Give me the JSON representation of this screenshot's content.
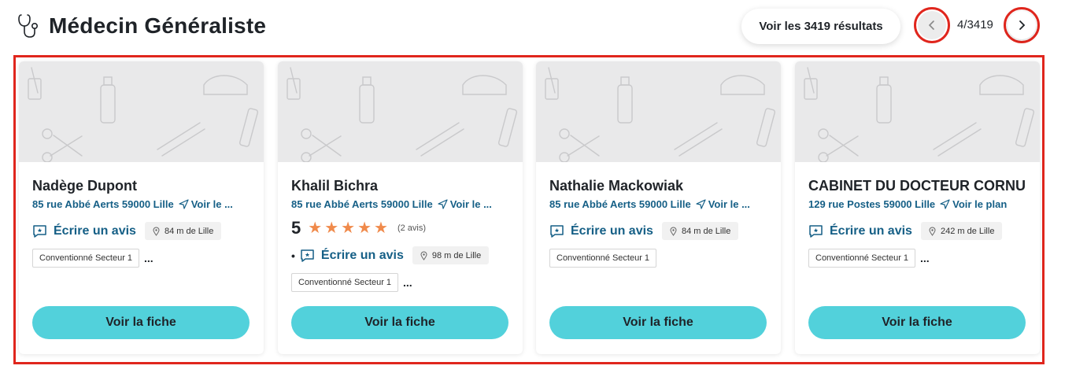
{
  "header": {
    "title": "Médecin Généraliste",
    "results_button": "Voir les 3419 résultats",
    "counter": "4/3419"
  },
  "cards": [
    {
      "name": "Nadège Dupont",
      "address": "85 rue Abbé Aerts 59000 Lille",
      "map_link": "Voir le ...",
      "review_link": "Écrire un avis",
      "distance": "84 m de Lille",
      "tag": "Conventionné Secteur 1",
      "more": "...",
      "button": "Voir la fiche"
    },
    {
      "name": "Khalil Bichra",
      "address": "85 rue Abbé Aerts 59000 Lille",
      "map_link": "Voir le ...",
      "rating": "5",
      "rating_value": 5,
      "rating_count": "(2 avis)",
      "bullet": "•",
      "review_link": "Écrire un avis",
      "distance": "98 m de Lille",
      "tag": "Conventionné Secteur 1",
      "more": "...",
      "button": "Voir la fiche"
    },
    {
      "name": "Nathalie Mackowiak",
      "address": "85 rue Abbé Aerts 59000 Lille",
      "map_link": "Voir le ...",
      "review_link": "Écrire un avis",
      "distance": "84 m de Lille",
      "tag": "Conventionné Secteur 1",
      "more": "",
      "button": "Voir la fiche"
    },
    {
      "name": "CABINET DU DOCTEUR CORNU",
      "address": "129 rue Postes 59000 Lille",
      "map_link": "Voir le plan",
      "review_link": "Écrire un avis",
      "distance": "242 m de Lille",
      "tag": "Conventionné Secteur 1",
      "more": "...",
      "button": "Voir la fiche"
    }
  ],
  "icons": {
    "title": "stethoscope-icon",
    "prev": "chevron-left-icon",
    "next": "chevron-right-icon",
    "address": "navigation-arrow-icon",
    "review": "review-bubble-icon",
    "distance": "location-pin-icon",
    "star": "star-icon"
  },
  "colors": {
    "link": "#155f86",
    "button": "#52d1db",
    "star": "#f08a4b",
    "highlight": "#e0261d",
    "banner": "#e9e9ea"
  }
}
